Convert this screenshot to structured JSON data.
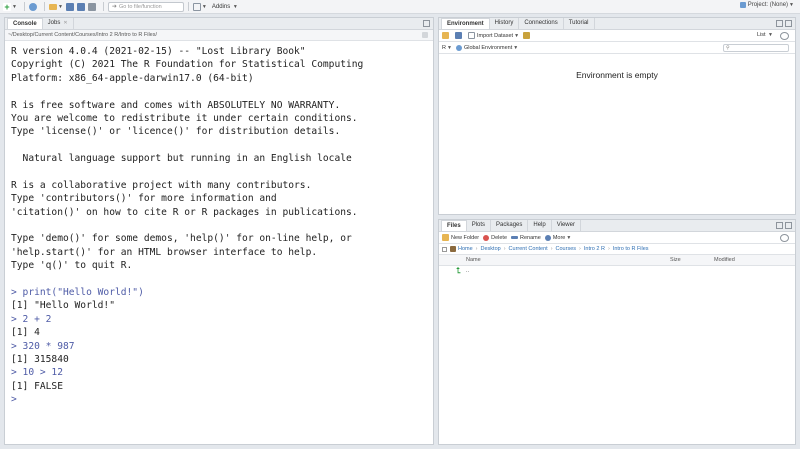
{
  "toolbar": {
    "goto_placeholder": "Go to file/function",
    "addins_label": "Addins",
    "project_label": "Project: (None)"
  },
  "console": {
    "tabs": [
      {
        "label": "Console"
      },
      {
        "label": "Jobs"
      }
    ],
    "path": "~/Desktop/Current Content/Courses/Intro 2 R/Intro to R Files/",
    "lines": [
      {
        "text": "R version 4.0.4 (2021-02-15) -- \"Lost Library Book\"",
        "kind": "out"
      },
      {
        "text": "Copyright (C) 2021 The R Foundation for Statistical Computing",
        "kind": "out"
      },
      {
        "text": "Platform: x86_64-apple-darwin17.0 (64-bit)",
        "kind": "out"
      },
      {
        "text": "",
        "kind": "blank"
      },
      {
        "text": "R is free software and comes with ABSOLUTELY NO WARRANTY.",
        "kind": "out"
      },
      {
        "text": "You are welcome to redistribute it under certain conditions.",
        "kind": "out"
      },
      {
        "text": "Type 'license()' or 'licence()' for distribution details.",
        "kind": "out"
      },
      {
        "text": "",
        "kind": "blank"
      },
      {
        "text": "  Natural language support but running in an English locale",
        "kind": "out"
      },
      {
        "text": "",
        "kind": "blank"
      },
      {
        "text": "R is a collaborative project with many contributors.",
        "kind": "out"
      },
      {
        "text": "Type 'contributors()' for more information and",
        "kind": "out"
      },
      {
        "text": "'citation()' on how to cite R or R packages in publications.",
        "kind": "out"
      },
      {
        "text": "",
        "kind": "blank"
      },
      {
        "text": "Type 'demo()' for some demos, 'help()' for on-line help, or",
        "kind": "out"
      },
      {
        "text": "'help.start()' for an HTML browser interface to help.",
        "kind": "out"
      },
      {
        "text": "Type 'q()' to quit R.",
        "kind": "out"
      },
      {
        "text": "",
        "kind": "blank"
      },
      {
        "text": "> print(\"Hello World!\")",
        "kind": "cmd"
      },
      {
        "text": "[1] \"Hello World!\"",
        "kind": "out"
      },
      {
        "text": "> 2 + 2",
        "kind": "cmd"
      },
      {
        "text": "[1] 4",
        "kind": "out"
      },
      {
        "text": "> 320 * 987",
        "kind": "cmd"
      },
      {
        "text": "[1] 315840",
        "kind": "out"
      },
      {
        "text": "> 10 > 12",
        "kind": "cmd"
      },
      {
        "text": "[1] FALSE",
        "kind": "out"
      },
      {
        "text": ">",
        "kind": "cmd"
      }
    ]
  },
  "environment": {
    "tabs": [
      {
        "label": "Environment"
      },
      {
        "label": "History"
      },
      {
        "label": "Connections"
      },
      {
        "label": "Tutorial"
      }
    ],
    "import_label": "Import Dataset",
    "list_label": "List",
    "lang_label": "R",
    "scope_label": "Global Environment",
    "empty_message": "Environment is empty"
  },
  "files": {
    "tabs": [
      {
        "label": "Files"
      },
      {
        "label": "Plots"
      },
      {
        "label": "Packages"
      },
      {
        "label": "Help"
      },
      {
        "label": "Viewer"
      }
    ],
    "new_folder_label": "New Folder",
    "delete_label": "Delete",
    "rename_label": "Rename",
    "more_label": "More",
    "breadcrumb": [
      "Home",
      "Desktop",
      "Current Content",
      "Courses",
      "Intro 2 R",
      "Intro to R Files"
    ],
    "columns": {
      "name": "Name",
      "size": "Size",
      "modified": "Modified"
    },
    "rows": [
      {
        "name": ".."
      }
    ]
  },
  "colors": {
    "command": "#4e5ba6",
    "link": "#2f6fb3"
  }
}
